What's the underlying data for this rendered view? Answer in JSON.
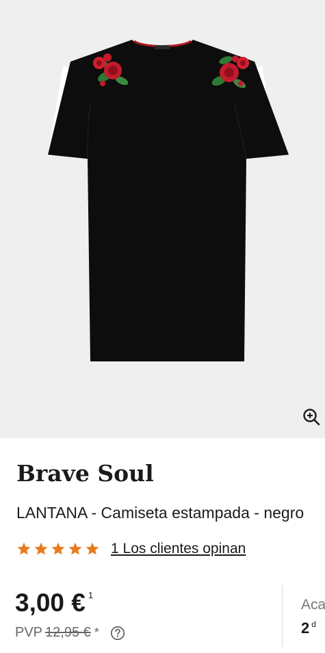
{
  "product": {
    "brand": "Brave Soul",
    "name": "LANTANA - Camiseta estampada - negro",
    "image_alt": "Camiseta negra con rosas bordadas en los hombros"
  },
  "rating": {
    "stars": 5,
    "max_stars": 5,
    "reviews_text": "1 Los clientes opinan"
  },
  "pricing": {
    "price": "3,00 €",
    "price_footnote": "1",
    "rrp_label": "PVP",
    "rrp_value": "12,95 €",
    "rrp_asterisk": "*"
  },
  "delivery": {
    "label": "Aca",
    "value": "2",
    "value_suffix": "d"
  },
  "icons": {
    "zoom": "zoom-in-icon",
    "help": "help-circle-icon",
    "star": "star-icon"
  },
  "colors": {
    "star": "#e87c1e",
    "text": "#1a1a1a",
    "muted": "#666666",
    "hero_bg": "#efefef"
  }
}
